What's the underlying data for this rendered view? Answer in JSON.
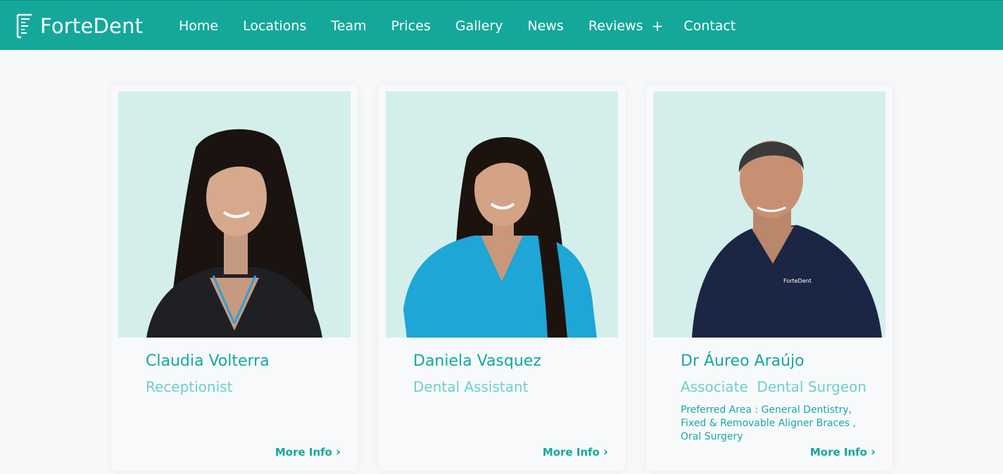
{
  "brand": {
    "name": "ForteDent"
  },
  "nav": {
    "items": [
      {
        "label": "Home"
      },
      {
        "label": "Locations"
      },
      {
        "label": "Team"
      },
      {
        "label": "Prices"
      },
      {
        "label": "Gallery"
      },
      {
        "label": "News"
      },
      {
        "label": "Reviews",
        "has_submenu": true,
        "submenu_icon": "plus"
      },
      {
        "label": "Contact"
      }
    ]
  },
  "team": [
    {
      "name": "Claudia Volterra",
      "role": "Receptionist",
      "more_label": "More Info",
      "photo": "woman-black-scrubs-photo"
    },
    {
      "name": "Daniela Vasquez",
      "role": "Dental Assistant",
      "more_label": "More Info",
      "photo": "woman-blue-scrubs-photo"
    },
    {
      "name": "Dr Áureo Araújo",
      "role": "Associate  Dental Surgeon",
      "preferred_area": "Preferred Area : General Dentistry, Fixed & Removable Aligner Braces , Oral Surgery",
      "more_label": "More Info",
      "photo": "man-navy-scrubs-photo"
    }
  ],
  "colors": {
    "primary": "#14a89b",
    "accent_light": "#6ed0c9",
    "photo_bg": "#d4efeb",
    "page_bg": "#f6f8fa"
  }
}
